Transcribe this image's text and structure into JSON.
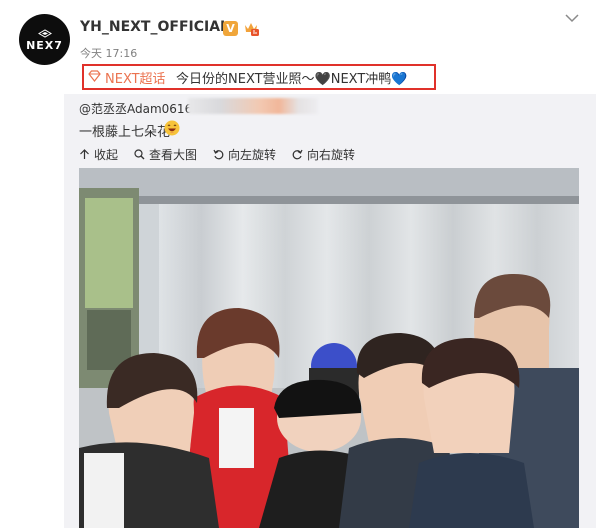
{
  "header": {
    "avatar_text": "NEX7",
    "username": "YH_NEXT_OFFICIAL",
    "verified_badge": "V",
    "post_time": "今天 17:16",
    "icons": [
      "nex7-logo-icon",
      "vip-member-icon",
      "chevron-down-icon"
    ]
  },
  "post": {
    "topic_name": "NEXT超话",
    "text": "今日份的NEXT营业照～🖤NEXT冲鸭💙",
    "highlight_color": "#e0312a",
    "topic_color": "#eb7350"
  },
  "retweet": {
    "user": "@范丞丞Adam0616",
    "text": "一根藤上七朵花",
    "emoji": "laughing-emoji",
    "tools": [
      {
        "label": "收起",
        "icon": "collapse-icon"
      },
      {
        "label": "查看大图",
        "icon": "zoom-icon"
      },
      {
        "label": "向左旋转",
        "icon": "rotate-left-icon"
      },
      {
        "label": "向右旋转",
        "icon": "rotate-right-icon"
      }
    ],
    "photo": "group-photo"
  }
}
